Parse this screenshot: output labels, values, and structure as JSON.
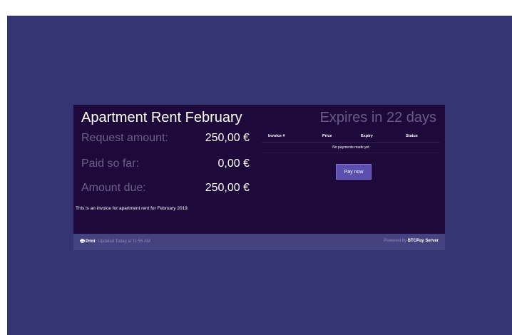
{
  "invoice": {
    "title": "Apartment Rent February",
    "expires_text": "Expires in 22 days",
    "summary": [
      {
        "label": "Request amount:",
        "value": "250,00 €"
      },
      {
        "label": "Paid so far:",
        "value": "0,00 €"
      },
      {
        "label": "Amount due:",
        "value": "250,00 €"
      }
    ],
    "description": "This is an invoice for apartment rent for February 2019."
  },
  "payments_table": {
    "headers": [
      "Invoice #",
      "Price",
      "Expiry",
      "Status"
    ],
    "empty_message": "No payments made yet",
    "pay_button": "Pay now"
  },
  "footer": {
    "print_label": "Print",
    "updated_text": "Updated Today at 11:55 AM",
    "powered_prefix": "Powered by",
    "powered_brand": "BTCPay Server"
  },
  "colors": {
    "page_background": "#363574",
    "card_background": "#1d0a3b",
    "footer_background": "#45437f",
    "accent_button": "#5c4fb0"
  }
}
